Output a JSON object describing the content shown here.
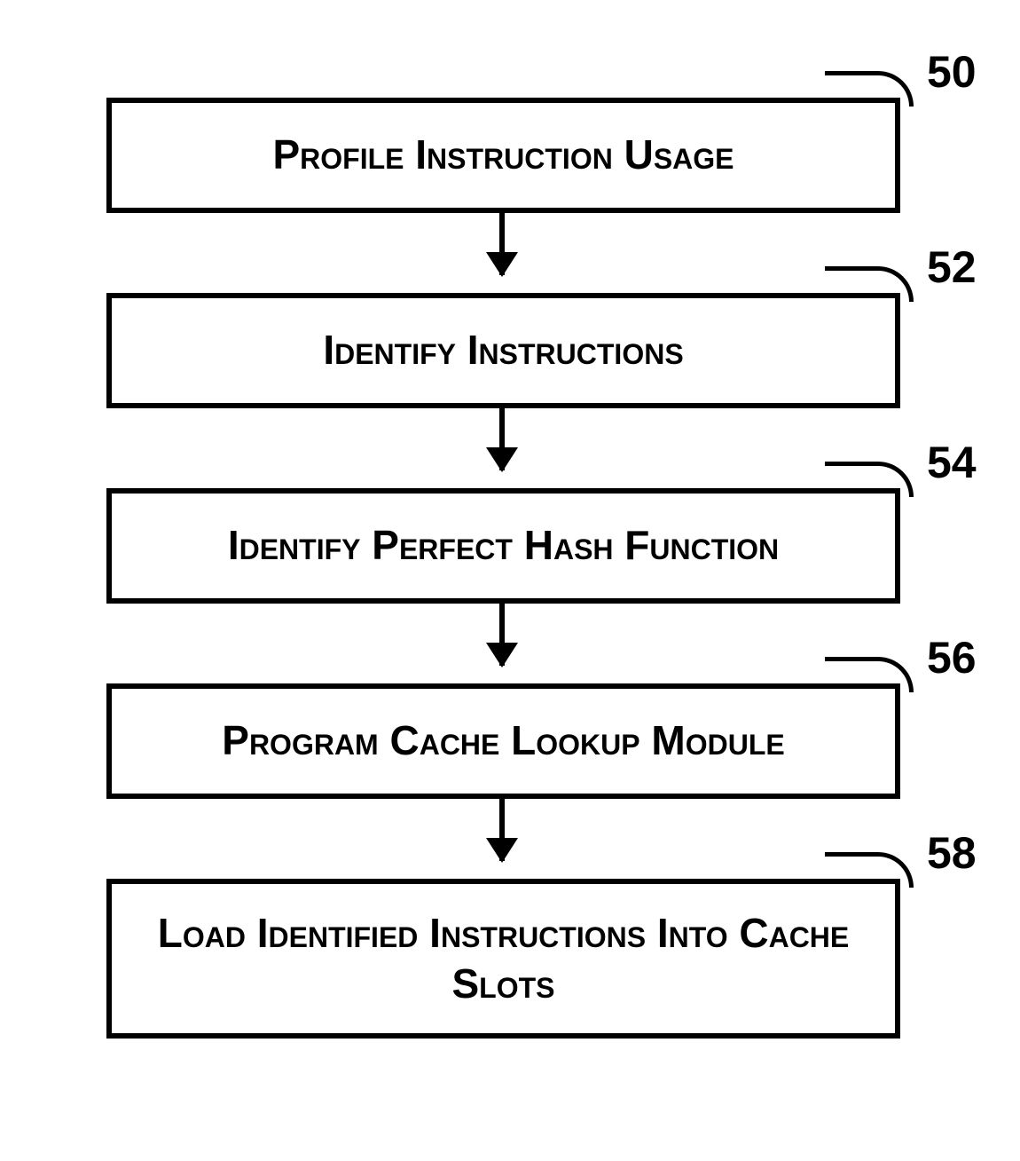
{
  "boxes": [
    {
      "label": "Profile Instruction Usage",
      "ref": "50"
    },
    {
      "label": "Identify Instructions",
      "ref": "52"
    },
    {
      "label": "Identify Perfect Hash Function",
      "ref": "54"
    },
    {
      "label": "Program Cache Lookup Module",
      "ref": "56"
    },
    {
      "label": "Load Identified Instructions Into Cache Slots",
      "ref": "58"
    }
  ]
}
